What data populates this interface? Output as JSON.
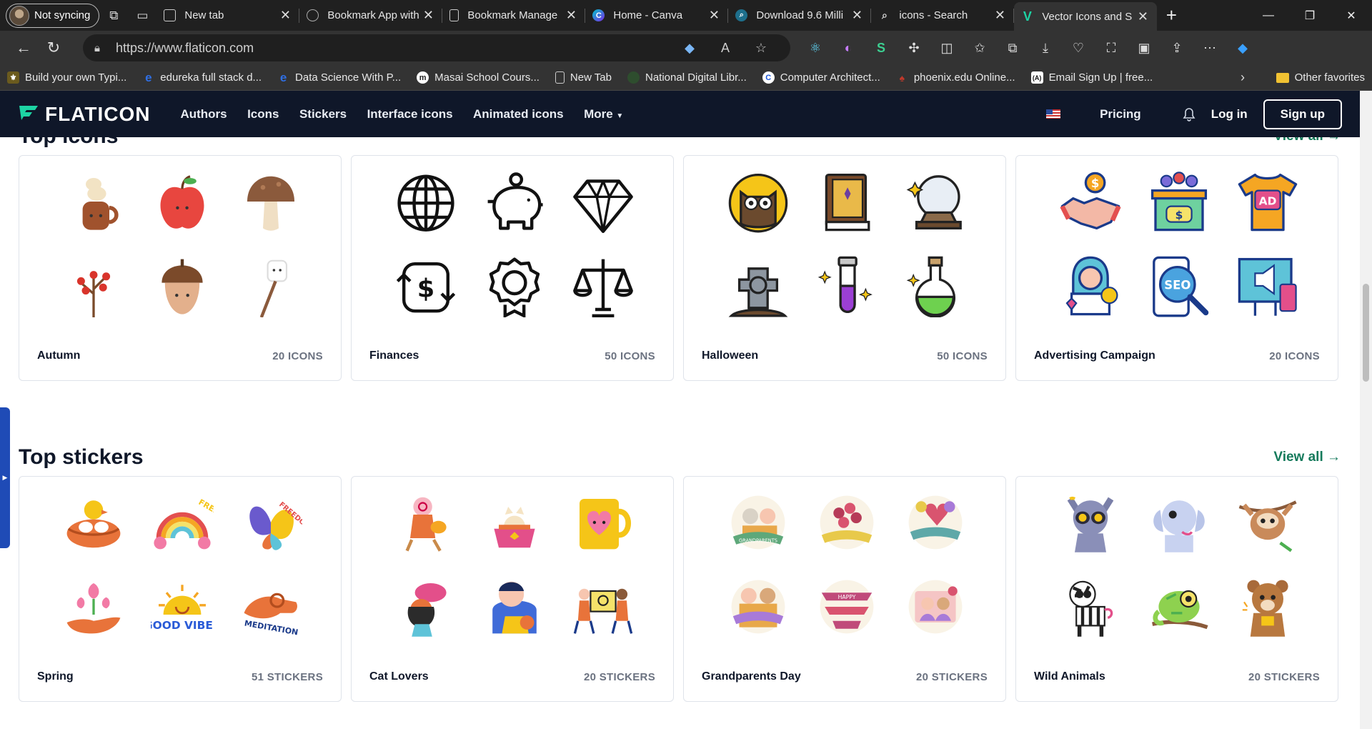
{
  "browser": {
    "profile_label": "Not syncing",
    "tabs": [
      {
        "title": "New tab"
      },
      {
        "title": "Bookmark App with"
      },
      {
        "title": "Bookmark Manage"
      },
      {
        "title": "Home - Canva"
      },
      {
        "title": "Download 9.6 Milli"
      },
      {
        "title": "icons - Search"
      },
      {
        "title": "Vector Icons and S"
      }
    ],
    "url": "https://www.flaticon.com",
    "bookmarks": [
      {
        "label": "Build your own Typi..."
      },
      {
        "label": "edureka full stack d..."
      },
      {
        "label": "Data Science With P..."
      },
      {
        "label": "Masai School Cours..."
      },
      {
        "label": "New Tab"
      },
      {
        "label": "National Digital Libr..."
      },
      {
        "label": "Computer Architect..."
      },
      {
        "label": "phoenix.edu Online..."
      },
      {
        "label": "Email Sign Up | free..."
      }
    ],
    "other_favorites": "Other favorites"
  },
  "site": {
    "logo": "FLATICON",
    "nav": [
      "Authors",
      "Icons",
      "Stickers",
      "Interface icons",
      "Animated icons",
      "More"
    ],
    "pricing": "Pricing",
    "login": "Log in",
    "signup": "Sign up",
    "accent_color": "#157a5b",
    "header_bg": "#0f1729"
  },
  "top_icons": {
    "title": "Top icons",
    "view_all": "View all",
    "packs": [
      {
        "name": "Autumn",
        "count": "20 ICONS",
        "icons": [
          "coffee-cup-icon",
          "apple-icon",
          "mushroom-icon",
          "berry-branch-icon",
          "acorn-icon",
          "marshmallow-icon"
        ]
      },
      {
        "name": "Finances",
        "count": "50 ICONS",
        "icons": [
          "globe-icon",
          "piggy-bank-icon",
          "diamond-icon",
          "money-exchange-icon",
          "award-badge-icon",
          "scales-icon"
        ]
      },
      {
        "name": "Halloween",
        "count": "50 ICONS",
        "icons": [
          "owl-icon",
          "spell-book-icon",
          "crystal-ball-icon",
          "gravestone-icon",
          "potion-tube-icon",
          "potion-flask-icon"
        ]
      },
      {
        "name": "Advertising Campaign",
        "count": "20 ICONS",
        "icons": [
          "handshake-icon",
          "audience-icon",
          "ad-tshirt-icon",
          "influencer-icon",
          "seo-phone-icon",
          "billboard-icon"
        ]
      }
    ]
  },
  "top_stickers": {
    "title": "Top stickers",
    "view_all": "View all",
    "packs": [
      {
        "name": "Spring",
        "count": "51 STICKERS",
        "icons": [
          "nest-chick-icon",
          "rainbow-icon",
          "butterfly-icon",
          "flower-hand-icon",
          "good-vibes-sun-icon",
          "meditation-hand-icon"
        ]
      },
      {
        "name": "Cat Lovers",
        "count": "20 STICKERS",
        "icons": [
          "grandma-cat-icon",
          "cat-bowl-icon",
          "cat-mug-icon",
          "woman-cat-icon",
          "boy-cat-icon",
          "people-cat-sign-icon"
        ]
      },
      {
        "name": "Grandparents Day",
        "count": "20 STICKERS",
        "icons": [
          "grandparents-banner-icon",
          "flowers-banner-icon",
          "balloons-banner-icon",
          "grandparents-couple-icon",
          "happy-grandparents-day-icon",
          "family-photo-icon"
        ]
      },
      {
        "name": "Wild Animals",
        "count": "20 STICKERS",
        "icons": [
          "raccoon-icon",
          "elephant-icon",
          "sloth-icon",
          "zebra-icon",
          "chameleon-icon",
          "bear-icon"
        ]
      }
    ],
    "sticker_texts": {
      "fresh": "FRESH",
      "freedom": "FREEDOM",
      "good_vibes": "GOOD VIBES",
      "meditation": "MEDITATION",
      "seo": "SEO",
      "ad": "AD"
    }
  }
}
